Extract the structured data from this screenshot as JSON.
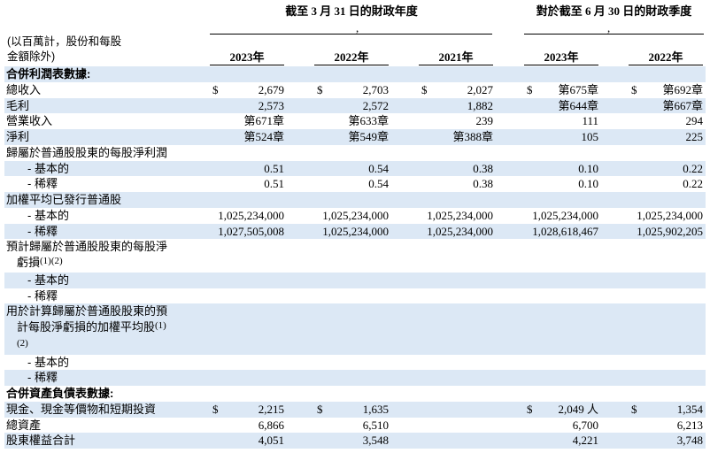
{
  "header": {
    "fiscal_year_group": "截至 3 月 31 日的財政年度",
    "fiscal_year_mark": ",",
    "fiscal_quarter_group": "對於截至 6 月 30 日的財政季度",
    "fiscal_quarter_mark": ",",
    "units_note": [
      "(以百萬計，股份和每股",
      "金額除外)"
    ],
    "columns": [
      "2023年",
      "2022年",
      "2021年",
      "2023年",
      "2022年"
    ]
  },
  "table": {
    "rows": [
      {
        "label": "合併利潤表數據:"
      },
      {
        "label": "總收入",
        "symbols": [
          "$",
          "$",
          "$",
          "$",
          "$"
        ],
        "values": [
          "2,679",
          "2,703",
          "2,027",
          "第675章",
          "第692章"
        ]
      },
      {
        "label": "毛利",
        "values": [
          "2,573",
          "2,572",
          "1,882",
          "第644章",
          "第667章"
        ]
      },
      {
        "label": "營業收入",
        "values": [
          "第671章",
          "第633章",
          "239",
          "111",
          "294"
        ]
      },
      {
        "label": "淨利",
        "values": [
          "第524章",
          "第549章",
          "第388章",
          "105",
          "225"
        ]
      },
      {
        "label": "歸屬於普通股股東的每股淨利潤"
      },
      {
        "label": "- 基本的",
        "values": [
          "0.51",
          "0.54",
          "0.38",
          "0.10",
          "0.22"
        ]
      },
      {
        "label": "- 稀釋",
        "values": [
          "0.51",
          "0.54",
          "0.38",
          "0.10",
          "0.22"
        ]
      },
      {
        "label": "加權平均已發行普通股"
      },
      {
        "label": "- 基本的",
        "values": [
          "1,025,234,000",
          "1,025,234,000",
          "1,025,234,000",
          "1,025,234,000",
          "1,025,234,000"
        ]
      },
      {
        "label": "- 稀釋",
        "values": [
          "1,027,505,008",
          "1,025,234,000",
          "1,025,234,000",
          "1,028,618,467",
          "1,025,902,205"
        ]
      },
      {
        "label_lines": [
          {
            "text": "預計歸屬於普通股股東的每股淨"
          },
          {
            "text": "虧損",
            "sup": "(1)(2)"
          }
        ]
      },
      {
        "label": "- 基本的"
      },
      {
        "label": "- 稀釋"
      },
      {
        "label_lines": [
          {
            "text": "用於計算歸屬於普通股股東的預"
          },
          {
            "text": "計每股淨虧損的加權平均股",
            "sup": "(1)"
          },
          {
            "sup": "(2)"
          }
        ]
      },
      {
        "label": "- 基本的"
      },
      {
        "label": "- 稀釋"
      },
      {
        "label": "合併資產負債表數據:"
      },
      {
        "label": "現金、現金等價物和短期投資",
        "symbols": [
          "$",
          "$",
          "",
          "$",
          "$"
        ],
        "values": [
          "2,215",
          "1,635",
          "",
          "2,049 人",
          "1,354"
        ]
      },
      {
        "label": "總資產",
        "values": [
          "6,866",
          "6,510",
          "",
          "6,700",
          "6,213"
        ]
      },
      {
        "label": "股東權益合計",
        "values": [
          "4,051",
          "3,548",
          "",
          "4,221",
          "3,748"
        ]
      }
    ]
  },
  "colors": {
    "row_shading": "#dce8f5",
    "text": "#000000"
  }
}
